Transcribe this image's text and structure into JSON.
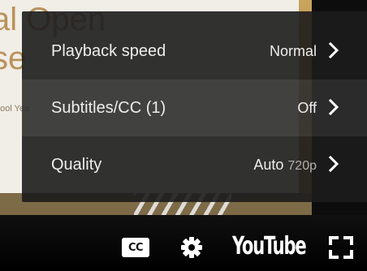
{
  "background_slide": {
    "title_fragment": "al Open\nse",
    "small_text": "hool Yea"
  },
  "settings_menu": {
    "items": [
      {
        "label": "Playback speed",
        "value": "Normal",
        "value_sub": ""
      },
      {
        "label": "Subtitles/CC (1)",
        "value": "Off",
        "value_sub": ""
      },
      {
        "label": "Quality",
        "value": "Auto",
        "value_sub": "720p"
      }
    ]
  },
  "controls": {
    "cc_label": "CC",
    "logo_text": "YouTube",
    "icons": [
      "subtitles-icon",
      "settings-gear-icon",
      "youtube-logo",
      "fullscreen-icon"
    ]
  }
}
